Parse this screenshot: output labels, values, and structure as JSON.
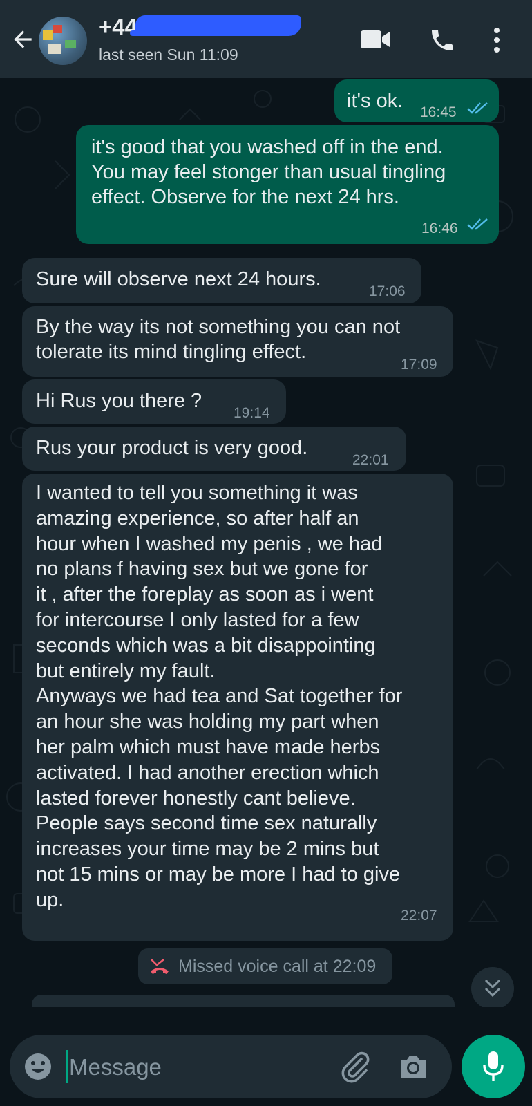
{
  "header": {
    "contact_name": "+44",
    "status": "last seen Sun 11:09"
  },
  "messages": [
    {
      "direction": "out",
      "text": "it's ok.",
      "time": "16:45",
      "read": true
    },
    {
      "direction": "out",
      "text": "it's good that you washed off in the end. You may feel stonger than usual tingling effect. Observe for the next 24 hrs.",
      "time": "16:46",
      "read": true
    },
    {
      "direction": "in",
      "text": "Sure will observe next 24 hours.",
      "time": "17:06"
    },
    {
      "direction": "in",
      "text": "By the way its not something you can not tolerate its mind tingling effect.",
      "time": "17:09"
    },
    {
      "direction": "in",
      "text": "Hi Rus you there ?",
      "time": "19:14"
    },
    {
      "direction": "in",
      "text": "Rus your product is very good.",
      "time": "22:01"
    },
    {
      "direction": "in",
      "text": "I wanted to tell you something it was amazing experience, so after half an hour when I washed my penis , we had no plans f having sex but we gone for it , after the foreplay as soon as i went for intercourse I only lasted for a few seconds which was a bit disappointing but entirely my fault. Anyways we had tea and Sat together for an hour she was holding my part when her palm which must have made herbs activated. I had another erection which lasted forever honestly cant believe. People says second time sex naturally increases your time may be 2 mins but not 15 mins or may be more I had to give up.",
      "time": "22:07"
    }
  ],
  "message_lines": {
    "m1": [
      "it's good that you washed off in the end.",
      "You may feel stonger than usual tingling",
      "effect. Observe for the next 24 hrs."
    ],
    "m3": [
      "By the way its not something you can not",
      "tolerate its mind tingling effect."
    ],
    "m6": [
      "I wanted to tell you something it was",
      "amazing experience, so after half an",
      "hour when I washed my penis , we had",
      "no plans f having sex but we gone for",
      "it , after the foreplay as soon as i went",
      "for intercourse I only lasted for a few",
      "seconds which was a bit disappointing",
      "but entirely my fault.",
      "Anyways we had tea and Sat together for",
      "an hour she was holding my part when",
      "her palm which must have made herbs",
      "activated. I had another erection which",
      "lasted forever honestly cant believe.",
      "People says second time sex naturally",
      "increases your time may be 2 mins but",
      "not 15 mins or may be more I had to give",
      "up."
    ]
  },
  "system": {
    "missed_call": "Missed voice call at 22:09"
  },
  "composer": {
    "placeholder": "Message"
  },
  "colors": {
    "outgoing_bubble": "#005c4b",
    "incoming_bubble": "#1f2c34",
    "read_ticks": "#53bdeb",
    "accent": "#00a884",
    "missed_call_icon": "#f15c6d"
  }
}
